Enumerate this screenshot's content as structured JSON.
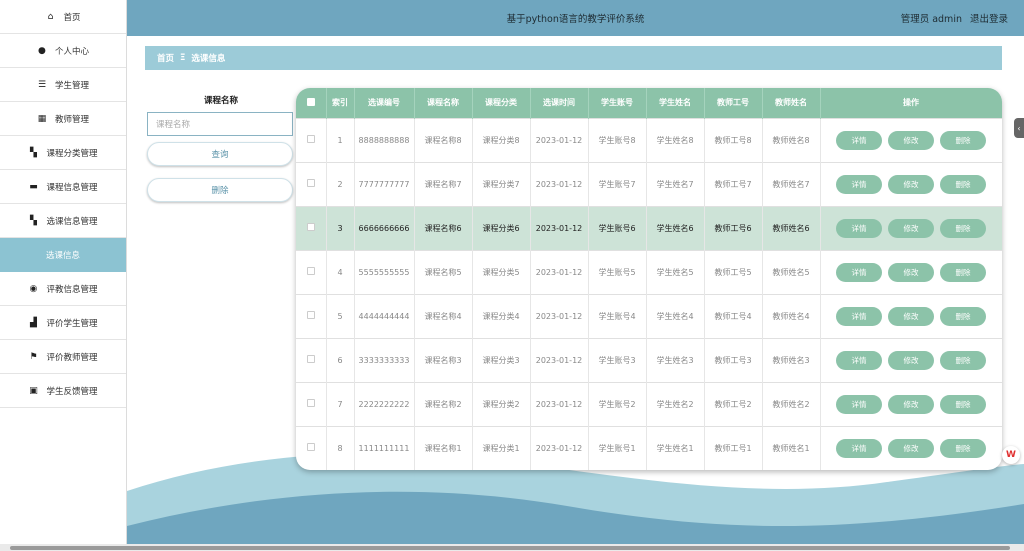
{
  "sidebar": {
    "items": [
      {
        "label": "首页",
        "icon": "home-icon",
        "glyph": "⌂"
      },
      {
        "label": "个人中心",
        "icon": "user-icon",
        "glyph": "●"
      },
      {
        "label": "学生管理",
        "icon": "sliders-icon",
        "glyph": "☰"
      },
      {
        "label": "教师管理",
        "icon": "grid-icon",
        "glyph": "▦"
      },
      {
        "label": "课程分类管理",
        "icon": "apps-icon",
        "glyph": "▚"
      },
      {
        "label": "课程信息管理",
        "icon": "inbox-icon",
        "glyph": "▬"
      },
      {
        "label": "选课信息管理",
        "icon": "apps-icon",
        "glyph": "▚"
      },
      {
        "label": "选课信息",
        "icon": "",
        "glyph": ""
      },
      {
        "label": "评教信息管理",
        "icon": "location-icon",
        "glyph": "◉"
      },
      {
        "label": "评价学生管理",
        "icon": "thumb-icon",
        "glyph": "▟"
      },
      {
        "label": "评价教师管理",
        "icon": "flag-icon",
        "glyph": "⚑"
      },
      {
        "label": "学生反馈管理",
        "icon": "briefcase-icon",
        "glyph": "▣"
      }
    ]
  },
  "header": {
    "title": "基于python语言的教学评价系统",
    "user": "管理员 admin",
    "logout": "退出登录"
  },
  "breadcrumb": {
    "home": "首页",
    "sep": "Ξ",
    "current": "选课信息"
  },
  "search": {
    "label": "课程名称",
    "placeholder": "课程名称",
    "query_button": "查询",
    "delete_button": "删除"
  },
  "table": {
    "columns": [
      "索引",
      "选课编号",
      "课程名称",
      "课程分类",
      "选课时间",
      "学生账号",
      "学生姓名",
      "教师工号",
      "教师姓名",
      "操作"
    ],
    "actions": {
      "detail": "详情",
      "edit": "修改",
      "delete": "删除"
    },
    "rows": [
      {
        "index": "1",
        "code": "8888888888",
        "course": "课程名称8",
        "category": "课程分类8",
        "time": "2023-01-12",
        "account": "学生账号8",
        "student": "学生姓名8",
        "teacher_no": "教师工号8",
        "teacher": "教师姓名8"
      },
      {
        "index": "2",
        "code": "7777777777",
        "course": "课程名称7",
        "category": "课程分类7",
        "time": "2023-01-12",
        "account": "学生账号7",
        "student": "学生姓名7",
        "teacher_no": "教师工号7",
        "teacher": "教师姓名7"
      },
      {
        "index": "3",
        "code": "6666666666",
        "course": "课程名称6",
        "category": "课程分类6",
        "time": "2023-01-12",
        "account": "学生账号6",
        "student": "学生姓名6",
        "teacher_no": "教师工号6",
        "teacher": "教师姓名6"
      },
      {
        "index": "4",
        "code": "5555555555",
        "course": "课程名称5",
        "category": "课程分类5",
        "time": "2023-01-12",
        "account": "学生账号5",
        "student": "学生姓名5",
        "teacher_no": "教师工号5",
        "teacher": "教师姓名5"
      },
      {
        "index": "5",
        "code": "4444444444",
        "course": "课程名称4",
        "category": "课程分类4",
        "time": "2023-01-12",
        "account": "学生账号4",
        "student": "学生姓名4",
        "teacher_no": "教师工号4",
        "teacher": "教师姓名4"
      },
      {
        "index": "6",
        "code": "3333333333",
        "course": "课程名称3",
        "category": "课程分类3",
        "time": "2023-01-12",
        "account": "学生账号3",
        "student": "学生姓名3",
        "teacher_no": "教师工号3",
        "teacher": "教师姓名3"
      },
      {
        "index": "7",
        "code": "2222222222",
        "course": "课程名称2",
        "category": "课程分类2",
        "time": "2023-01-12",
        "account": "学生账号2",
        "student": "学生姓名2",
        "teacher_no": "教师工号2",
        "teacher": "教师姓名2"
      },
      {
        "index": "8",
        "code": "1111111111",
        "course": "课程名称1",
        "category": "课程分类1",
        "time": "2023-01-12",
        "account": "学生账号1",
        "student": "学生姓名1",
        "teacher_no": "教师工号1",
        "teacher": "教师姓名1"
      }
    ]
  },
  "colors": {
    "header": "#6fa6bf",
    "accent_green": "#8cc3a9",
    "breadcrumb": "#9ccbd8",
    "highlight_row": "#cde3d7",
    "wave_light": "#a9d3de",
    "wave_dark": "#6fa6bf"
  }
}
